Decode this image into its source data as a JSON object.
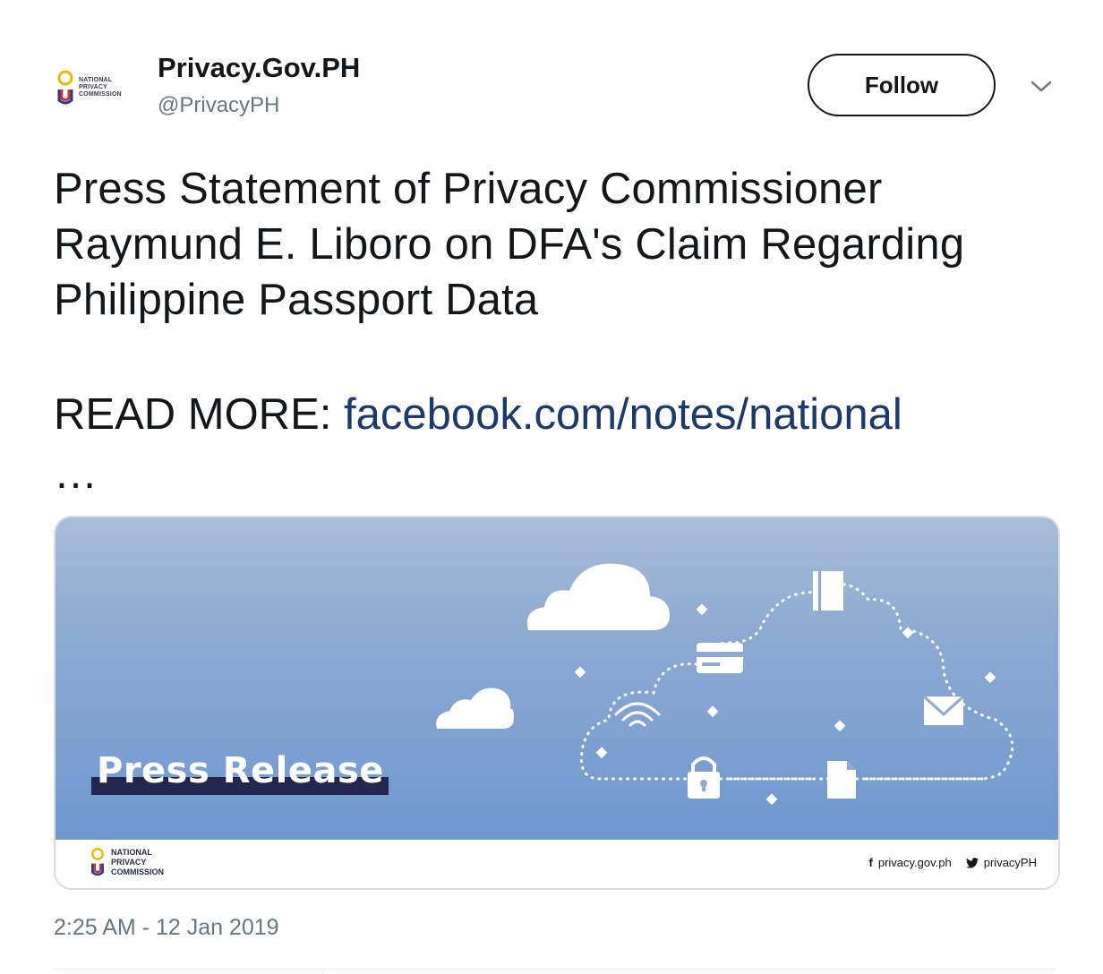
{
  "user": {
    "display_name": "Privacy.Gov.PH",
    "handle": "@PrivacyPH",
    "avatar_text_lines": [
      "NATIONAL",
      "PRIVACY",
      "COMMISSION"
    ]
  },
  "actions": {
    "follow_label": "Follow",
    "menu_icon": "chevron-down-icon"
  },
  "tweet": {
    "text": "Press Statement of Privacy Commissioner Raymund E. Liboro on DFA's Claim Regarding Philippine Passport Data",
    "read_more_prefix": "READ MORE: ",
    "link_text": "facebook.com/notes/national",
    "ellipsis": "…"
  },
  "card": {
    "banner_title": "Press Release",
    "footer_logo_lines": [
      "NATIONAL",
      "PRIVACY",
      "COMMISSION"
    ],
    "facebook_icon": "f",
    "facebook_text": "privacy.gov.ph",
    "twitter_icon": "twitter-bird-icon",
    "twitter_text": "privacyPH",
    "colors": {
      "banner_top": "#a9bdd7",
      "banner_bottom": "#6f98cf",
      "title_bar": "#24264f"
    }
  },
  "timestamp": "2:25 AM - 12 Jan 2019"
}
